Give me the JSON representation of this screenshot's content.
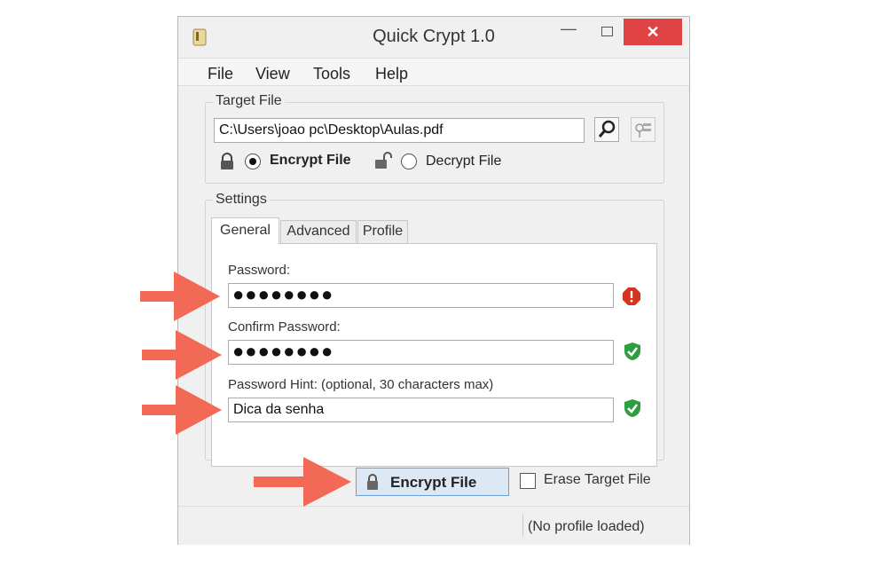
{
  "window": {
    "title": "Quick Crypt 1.0",
    "minimize_glyph": "—",
    "close_glyph": "✕"
  },
  "menu": [
    "File",
    "View",
    "Tools",
    "Help"
  ],
  "target_file": {
    "group_label": "Target File",
    "path": "C:\\Users\\joao pc\\Desktop\\Aulas.pdf",
    "browse_icon": "search-icon",
    "keys_icon": "keys-icon",
    "encrypt_label": "Encrypt File",
    "decrypt_label": "Decrypt File",
    "selected": "encrypt"
  },
  "settings": {
    "group_label": "Settings",
    "tabs": [
      "General",
      "Advanced",
      "Profile"
    ],
    "active_tab": "General",
    "password_label": "Password:",
    "password_value": "●●●●●●●●",
    "password_status": "error",
    "confirm_label": "Confirm Password:",
    "confirm_value": "●●●●●●●●",
    "confirm_status": "valid",
    "hint_label": "Password Hint: (optional, 30 characters max)",
    "hint_value": "Dica da senha",
    "hint_status": "valid"
  },
  "actions": {
    "encrypt_button_label": "Encrypt File",
    "erase_label": "Erase Target File",
    "erase_checked": false
  },
  "status": {
    "profile_text": "(No profile loaded)"
  },
  "colors": {
    "arrow": "#f26a55",
    "error": "#d9331f",
    "valid": "#2e9e3f",
    "close": "#e04343"
  }
}
